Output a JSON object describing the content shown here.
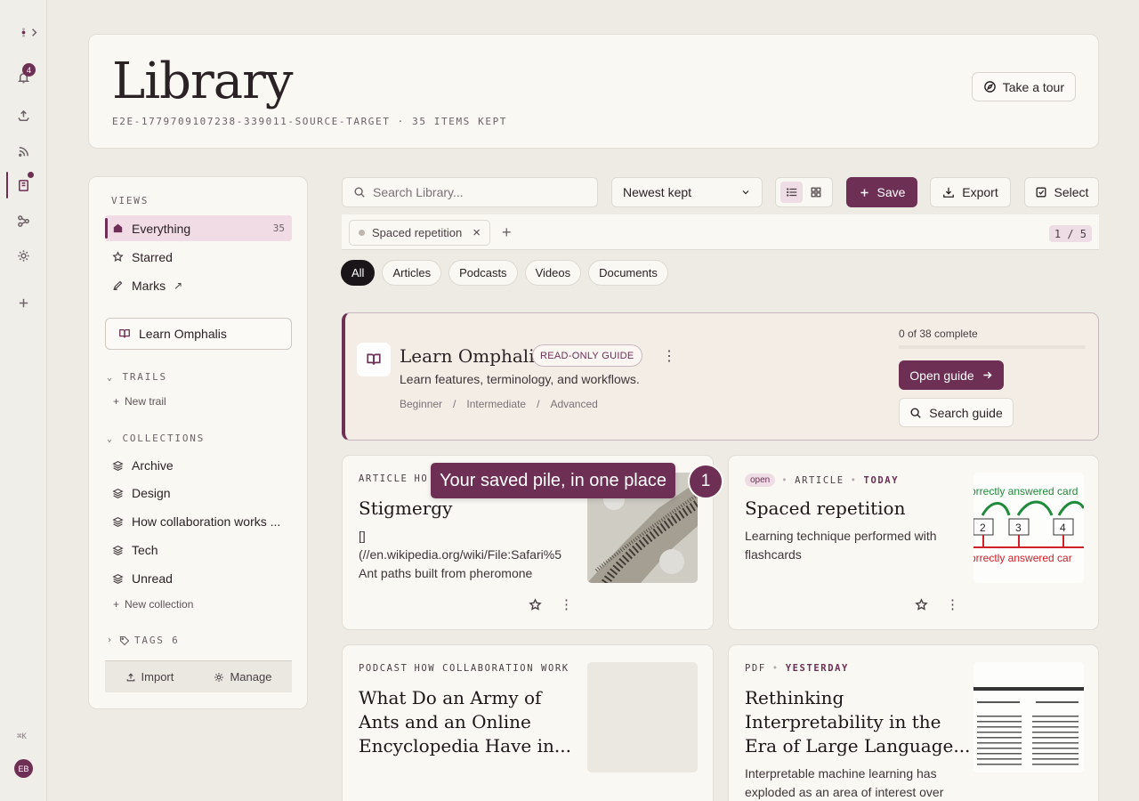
{
  "rail": {
    "notifications_count": "4",
    "shortcut": "⌘K",
    "avatar_initials": "EB"
  },
  "header": {
    "title": "Library",
    "subtitle": "E2E-1779709107238-339011-SOURCE-TARGET · 35 ITEMS KEPT",
    "tour_label": "Take a tour"
  },
  "sidebar": {
    "views_label": "VIEWS",
    "views": [
      {
        "label": "Everything",
        "count": "35"
      },
      {
        "label": "Starred"
      },
      {
        "label": "Marks",
        "suffix": "↗"
      }
    ],
    "learn_label": "Learn Omphalis",
    "trails_label": "TRAILS",
    "new_trail": "New trail",
    "collections_label": "COLLECTIONS",
    "collections": [
      "Archive",
      "Design",
      "How collaboration works ...",
      "Tech",
      "Unread"
    ],
    "new_collection": "New collection",
    "tags_label": "TAGS 6",
    "import_label": "Import",
    "manage_label": "Manage"
  },
  "toolbar": {
    "search_placeholder": "Search Library...",
    "sort_value": "Newest kept",
    "save_label": "Save",
    "export_label": "Export",
    "select_label": "Select"
  },
  "filters": {
    "chip_label": "Spaced repetition",
    "chip_close": "×",
    "add": "+",
    "pager": "1 / 5"
  },
  "tabs": [
    "All",
    "Articles",
    "Podcasts",
    "Videos",
    "Documents"
  ],
  "guide": {
    "title": "Learn Omphalis",
    "badge": "READ-ONLY GUIDE",
    "more": "⋮",
    "description": "Learn features, terminology, and workflows.",
    "levels": [
      "Beginner",
      "/",
      "Intermediate",
      "/",
      "Advanced"
    ],
    "progress_text": "0 of 38 complete",
    "progress_fraction": 0,
    "open_label": "Open guide",
    "search_label": "Search guide"
  },
  "cards": [
    {
      "type": "ARTICLE",
      "collection": "HO",
      "title": "Stigmergy",
      "desc_line1": "[]",
      "desc_line2": "(//en.wikipedia.org/wiki/File:Safari%5",
      "desc_line3": "Ant paths built from pheromone"
    },
    {
      "pill": "open",
      "type": "ARTICLE",
      "when": "TODAY",
      "title": "Spaced repetition",
      "desc_line1": "Learning technique performed with",
      "desc_line2": "flashcards",
      "thumb_top": "orrectly answered card",
      "thumb_bottom": "orrectly answered car",
      "boxes": [
        "2",
        "3",
        "4"
      ]
    },
    {
      "type": "PODCAST",
      "collection": "HOW COLLABORATION WORK",
      "title_line1": "What Do an Army of",
      "title_line2": "Ants and an Online",
      "title_line3": "Encyclopedia Have in..."
    },
    {
      "type": "PDF",
      "when": "YESTERDAY",
      "title_line1": "Rethinking",
      "title_line2": "Interpretability in the",
      "title_line3": "Era of Large Language...",
      "desc_line1": "Interpretable machine learning has",
      "desc_line2": "exploded as an area of interest over"
    }
  ],
  "tour": {
    "tooltip": "Your saved pile, in one place",
    "step": "1"
  },
  "colors": {
    "accent": "#6e2f55",
    "background": "#edebe4",
    "surface": "#faf8f3"
  }
}
